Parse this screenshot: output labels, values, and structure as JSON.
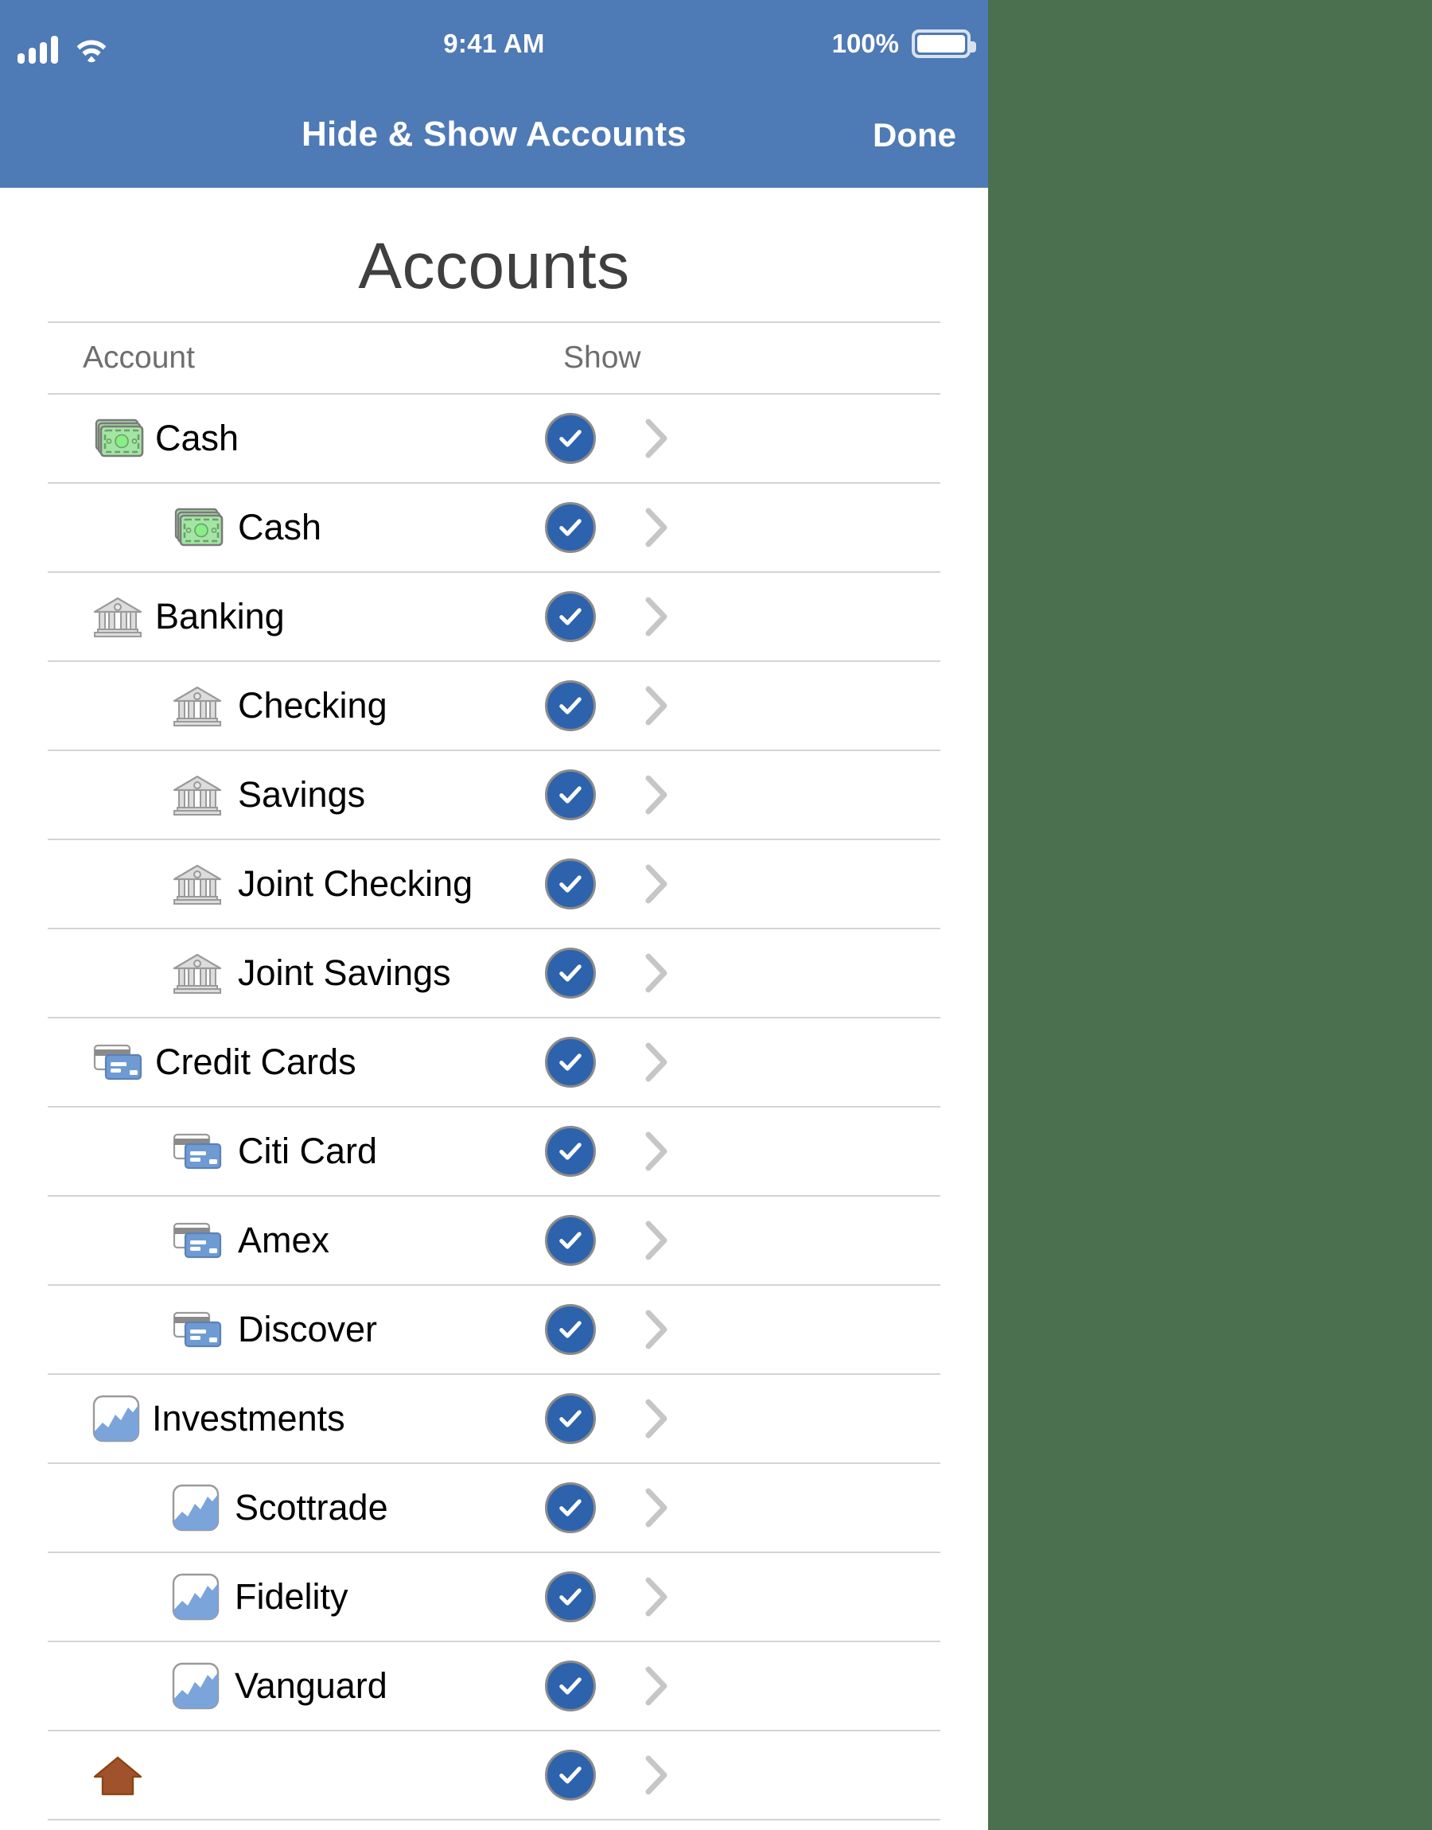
{
  "status_bar": {
    "time": "9:41 AM",
    "battery_percent": "100%",
    "signal_icon": "signal-bars-icon",
    "wifi_icon": "wifi-icon",
    "battery_icon": "battery-full-icon"
  },
  "nav_bar": {
    "title": "Hide & Show Accounts",
    "done_label": "Done"
  },
  "page": {
    "title": "Accounts"
  },
  "table": {
    "columns": {
      "account": "Account",
      "show": "Show"
    },
    "rows": [
      {
        "label": "Cash",
        "level": 0,
        "icon": "cash-icon",
        "shown": true
      },
      {
        "label": "Cash",
        "level": 1,
        "icon": "cash-icon",
        "shown": true
      },
      {
        "label": "Banking",
        "level": 0,
        "icon": "bank-icon",
        "shown": true
      },
      {
        "label": "Checking",
        "level": 1,
        "icon": "bank-icon",
        "shown": true
      },
      {
        "label": "Savings",
        "level": 1,
        "icon": "bank-icon",
        "shown": true
      },
      {
        "label": "Joint Checking",
        "level": 1,
        "icon": "bank-icon",
        "shown": true
      },
      {
        "label": "Joint Savings",
        "level": 1,
        "icon": "bank-icon",
        "shown": true
      },
      {
        "label": "Credit Cards",
        "level": 0,
        "icon": "credit-card-icon",
        "shown": true
      },
      {
        "label": "Citi Card",
        "level": 1,
        "icon": "credit-card-icon",
        "shown": true
      },
      {
        "label": "Amex",
        "level": 1,
        "icon": "credit-card-icon",
        "shown": true
      },
      {
        "label": "Discover",
        "level": 1,
        "icon": "credit-card-icon",
        "shown": true
      },
      {
        "label": "Investments",
        "level": 0,
        "icon": "chart-icon",
        "shown": true
      },
      {
        "label": "Scottrade",
        "level": 1,
        "icon": "chart-icon",
        "shown": true
      },
      {
        "label": "Fidelity",
        "level": 1,
        "icon": "chart-icon",
        "shown": true
      },
      {
        "label": "Vanguard",
        "level": 1,
        "icon": "chart-icon",
        "shown": true
      },
      {
        "label": "",
        "level": 0,
        "icon": "house-icon",
        "shown": true
      }
    ]
  },
  "colors": {
    "header_blue": "#4e7ab5",
    "check_blue": "#2d62ad",
    "page_background": "#4a7050",
    "separator": "#d4d4d4",
    "muted_text": "#6e6e6e"
  }
}
